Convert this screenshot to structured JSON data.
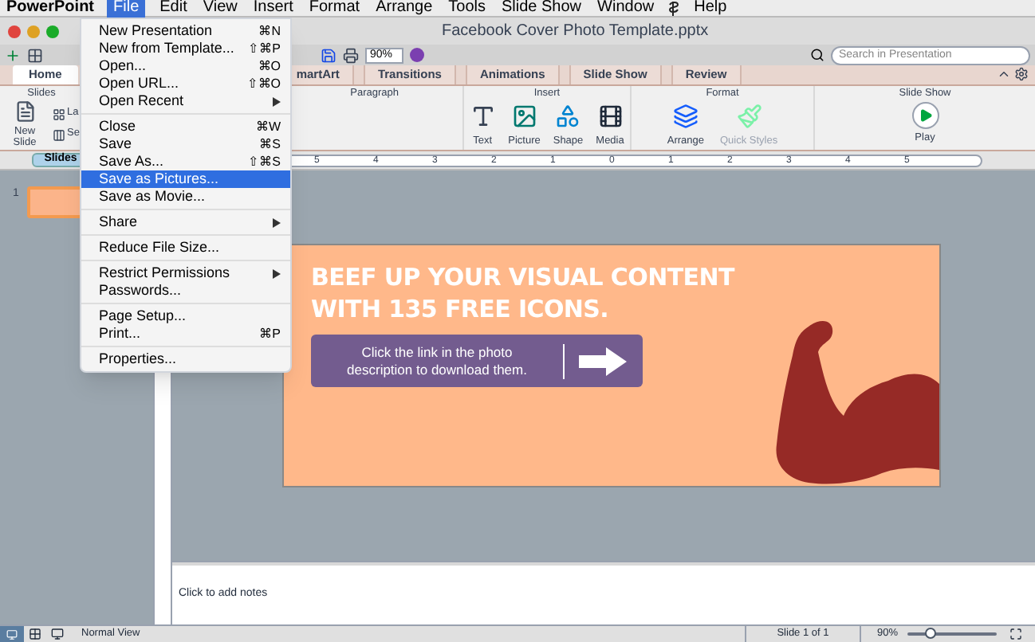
{
  "menubar": {
    "app": "PowerPoint",
    "items": [
      {
        "label": "File",
        "selected": true
      },
      {
        "label": "Edit",
        "selected": false
      },
      {
        "label": "View",
        "selected": false
      },
      {
        "label": "Insert",
        "selected": false
      },
      {
        "label": "Format",
        "selected": false
      },
      {
        "label": "Arrange",
        "selected": false
      },
      {
        "label": "Tools",
        "selected": false
      },
      {
        "label": "Slide Show",
        "selected": false
      },
      {
        "label": "Window",
        "selected": false
      },
      {
        "label": "Help",
        "selected": false
      }
    ]
  },
  "window": {
    "title": "Facebook Cover Photo Template.pptx"
  },
  "toolbar": {
    "zoom": "90%",
    "search": {
      "placeholder": "Search in Presentation"
    }
  },
  "ribbon": {
    "tabs": [
      {
        "label": "Home",
        "selected": true
      },
      {
        "label": "martArt",
        "selected": false
      },
      {
        "label": "Transitions",
        "selected": false
      },
      {
        "label": "Animations",
        "selected": false
      },
      {
        "label": "Slide Show",
        "selected": false
      },
      {
        "label": "Review",
        "selected": false
      }
    ],
    "slides_group": {
      "label": "Slides",
      "new_slide": "New Slide",
      "layout": "La",
      "section": "Se"
    },
    "paragraph_group": {
      "label": "Paragraph"
    },
    "insert_group": {
      "label": "Insert",
      "buttons": [
        {
          "label": "Text",
          "kind": "text"
        },
        {
          "label": "Picture",
          "kind": "picture"
        },
        {
          "label": "Shape",
          "kind": "shape"
        },
        {
          "label": "Media",
          "kind": "media"
        }
      ]
    },
    "format_group": {
      "label": "Format",
      "buttons": [
        {
          "label": "Arrange",
          "kind": "arrange",
          "disabled": false
        },
        {
          "label": "Quick Styles",
          "kind": "styles",
          "disabled": true
        }
      ]
    },
    "slideshow_group": {
      "label": "Slide Show",
      "play": "Play"
    }
  },
  "panel_tab": {
    "label": "Slides"
  },
  "ruler": [
    "5",
    "4",
    "3",
    "2",
    "1",
    "0",
    "1",
    "2",
    "3",
    "4",
    "5"
  ],
  "thumbnails": [
    {
      "number": "1",
      "selected": true
    }
  ],
  "slide": {
    "headline": [
      "BEEF UP YOUR VISUAL CONTENT",
      "WITH 135 FREE ICONS."
    ],
    "callout": [
      "Click the link in the photo",
      "description to download them."
    ]
  },
  "notes": {
    "placeholder": "Click to add notes"
  },
  "status_bar": {
    "view": "Normal View",
    "slide": "Slide 1 of 1",
    "zoom": "90%",
    "zoom_slider": {
      "level": 0.25
    }
  },
  "file_menu": {
    "groups": [
      [
        {
          "label": "New Presentation",
          "shortcut": "⌘N",
          "submenu": false,
          "selected": false
        },
        {
          "label": "New from Template...",
          "shortcut": "⇧⌘P",
          "submenu": false,
          "selected": false
        },
        {
          "label": "Open...",
          "shortcut": "⌘O",
          "submenu": false,
          "selected": false
        },
        {
          "label": "Open URL...",
          "shortcut": "⇧⌘O",
          "submenu": false,
          "selected": false
        },
        {
          "label": "Open Recent",
          "submenu": true,
          "selected": false
        }
      ],
      [
        {
          "label": "Close",
          "shortcut": "⌘W",
          "submenu": false,
          "selected": false
        },
        {
          "label": "Save",
          "shortcut": "⌘S",
          "submenu": false,
          "selected": false
        },
        {
          "label": "Save As...",
          "shortcut": "⇧⌘S",
          "submenu": false,
          "selected": false
        },
        {
          "label": "Save as Pictures...",
          "submenu": false,
          "selected": true
        },
        {
          "label": "Save as Movie...",
          "submenu": false,
          "selected": false
        }
      ],
      [
        {
          "label": "Share",
          "submenu": true,
          "selected": false
        }
      ],
      [
        {
          "label": "Reduce File Size...",
          "submenu": false,
          "selected": false
        }
      ],
      [
        {
          "label": "Restrict Permissions",
          "submenu": true,
          "selected": false
        },
        {
          "label": "Passwords...",
          "submenu": false,
          "selected": false
        }
      ],
      [
        {
          "label": "Page Setup...",
          "submenu": false,
          "selected": false
        },
        {
          "label": "Print...",
          "shortcut": "⌘P",
          "submenu": false,
          "selected": false
        }
      ],
      [
        {
          "label": "Properties...",
          "submenu": false,
          "selected": false
        }
      ]
    ]
  }
}
